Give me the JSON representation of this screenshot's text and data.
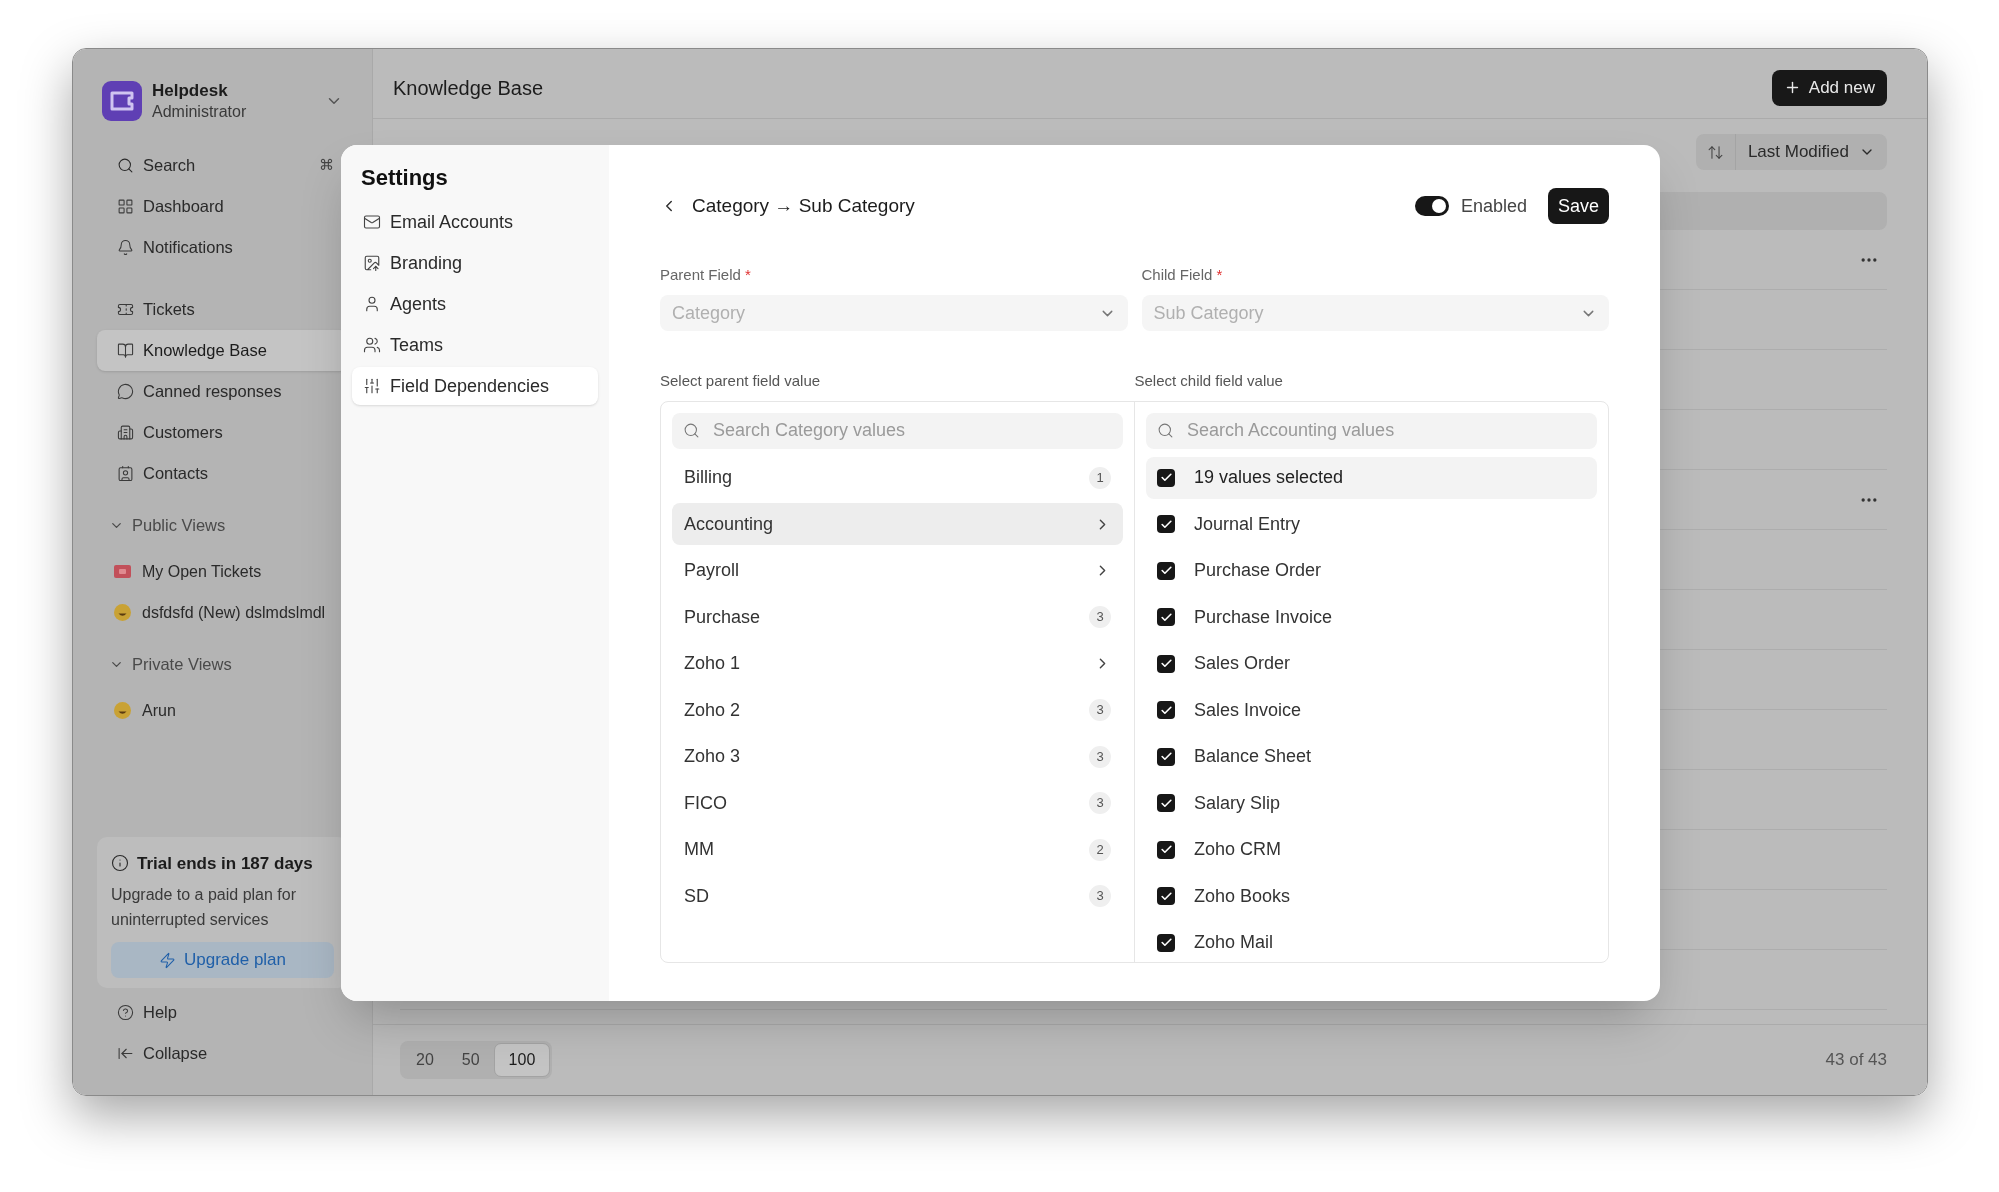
{
  "app": {
    "name": "Helpdesk",
    "role": "Administrator"
  },
  "sidebar": {
    "search": {
      "label": "Search",
      "shortcut": "⌘"
    },
    "primary": [
      {
        "label": "Dashboard",
        "selected": false
      },
      {
        "label": "Notifications",
        "selected": false
      }
    ],
    "main": [
      {
        "label": "Tickets",
        "selected": false
      },
      {
        "label": "Knowledge Base",
        "selected": true
      },
      {
        "label": "Canned responses",
        "selected": false
      },
      {
        "label": "Customers",
        "selected": false
      },
      {
        "label": "Contacts",
        "selected": false
      }
    ],
    "views": [
      {
        "title": "Public Views",
        "expanded": true,
        "items": [
          {
            "label": "My Open Tickets",
            "kind": "ticket"
          },
          {
            "label": "dsfdsfd (New) dslmdslmdl",
            "kind": "smiley"
          }
        ]
      },
      {
        "title": "Private Views",
        "expanded": true,
        "items": [
          {
            "label": "Arun",
            "kind": "smiley"
          }
        ]
      }
    ],
    "trial": {
      "title": "Trial ends in 187 days",
      "text": "Upgrade to a paid plan for uninterrupted services",
      "button": "Upgrade plan"
    },
    "footer": [
      {
        "label": "Help"
      },
      {
        "label": "Collapse"
      }
    ]
  },
  "page": {
    "title": "Knowledge Base",
    "add_button": "Add new",
    "sort": "Last Modified",
    "pagination": {
      "sizes": [
        {
          "label": "20",
          "selected": false
        },
        {
          "label": "50",
          "selected": false
        },
        {
          "label": "100",
          "selected": true
        }
      ],
      "count": "43 of 43"
    }
  },
  "settings": {
    "title": "Settings",
    "nav": [
      {
        "label": "Email Accounts",
        "selected": false
      },
      {
        "label": "Branding",
        "selected": false
      },
      {
        "label": "Agents",
        "selected": false
      },
      {
        "label": "Teams",
        "selected": false
      },
      {
        "label": "Field Dependencies",
        "selected": true
      }
    ],
    "header": {
      "title": "Category → Sub Category",
      "toggle": {
        "label": "Enabled",
        "on": true
      },
      "save": "Save"
    },
    "parent_field": {
      "label": "Parent Field",
      "required": "*",
      "value": "Category",
      "disabled": true
    },
    "child_field": {
      "label": "Child Field",
      "required": "*",
      "value": "Sub Category",
      "disabled": true
    },
    "parent_values": {
      "label": "Select parent field value",
      "search_placeholder": "Search Category values",
      "items": [
        {
          "label": "Billing",
          "kind": "count",
          "count": "1",
          "selected": false
        },
        {
          "label": "Accounting",
          "kind": "link",
          "selected": true
        },
        {
          "label": "Payroll",
          "kind": "link",
          "selected": false
        },
        {
          "label": "Purchase",
          "kind": "count",
          "count": "3",
          "selected": false
        },
        {
          "label": "Zoho 1",
          "kind": "link",
          "selected": false
        },
        {
          "label": "Zoho 2",
          "kind": "count",
          "count": "3",
          "selected": false
        },
        {
          "label": "Zoho 3",
          "kind": "count",
          "count": "3",
          "selected": false
        },
        {
          "label": "FICO",
          "kind": "count",
          "count": "3",
          "selected": false
        },
        {
          "label": "MM",
          "kind": "count",
          "count": "2",
          "selected": false
        },
        {
          "label": "SD",
          "kind": "count",
          "count": "3",
          "selected": false
        }
      ]
    },
    "child_values": {
      "label": "Select child field value",
      "search_placeholder": "Search Accounting values",
      "select_all": {
        "label": "19 values selected",
        "checked": true
      },
      "items": [
        {
          "label": "Journal Entry",
          "checked": true
        },
        {
          "label": "Purchase Order",
          "checked": true
        },
        {
          "label": "Purchase Invoice",
          "checked": true
        },
        {
          "label": "Sales Order",
          "checked": true
        },
        {
          "label": "Sales Invoice",
          "checked": true
        },
        {
          "label": "Balance Sheet",
          "checked": true
        },
        {
          "label": "Salary Slip",
          "checked": true
        },
        {
          "label": "Zoho CRM",
          "checked": true
        },
        {
          "label": "Zoho Books",
          "checked": true
        },
        {
          "label": "Zoho Mail",
          "checked": true
        }
      ]
    }
  }
}
